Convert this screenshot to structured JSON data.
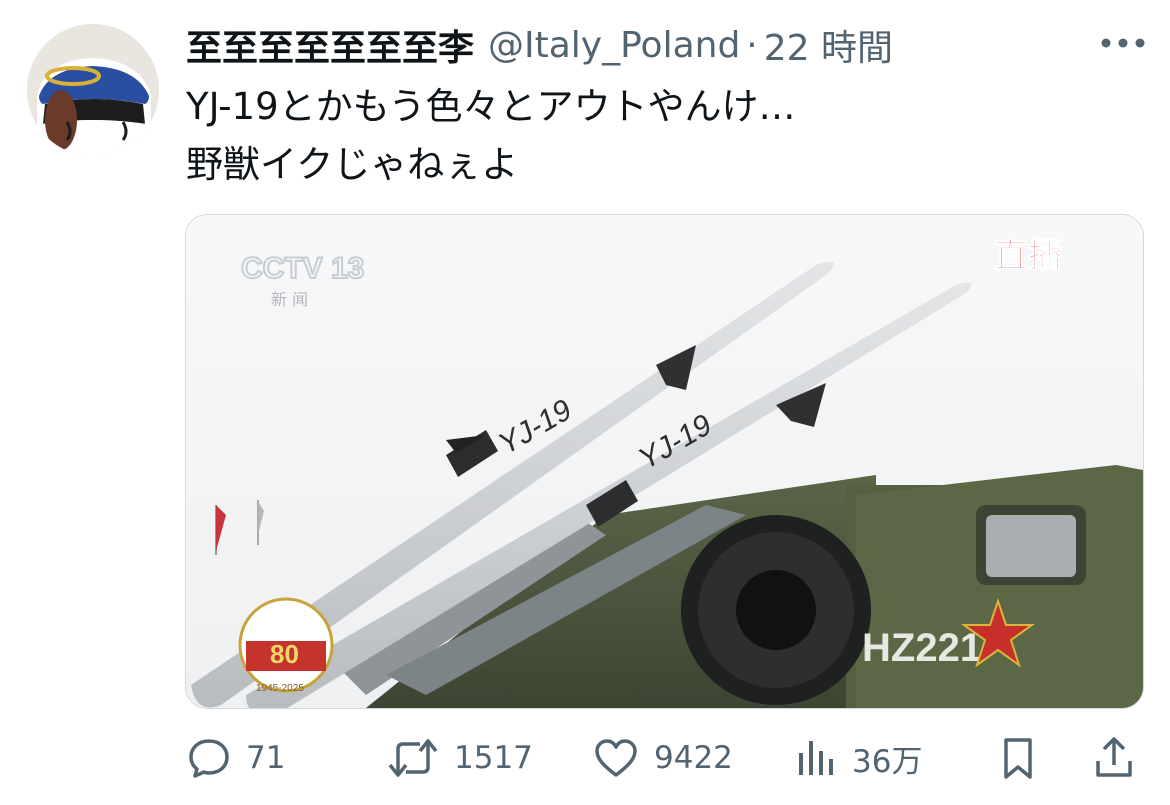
{
  "tweet": {
    "display_name": "至至至至至至至李",
    "handle": "@Italy_Poland",
    "separator": "·",
    "time": "22 時間",
    "text_lines": [
      "YJ-19とかもう色々とアウトやんけ…",
      "野獣イクじゃねぇよ"
    ]
  },
  "media": {
    "channel_logo": "CCTV 13",
    "channel_sub": "新 闻",
    "live_badge": "直播",
    "missile_label": "YJ-19",
    "vehicle_code": "HZ221",
    "anniversary_number": "80",
    "anniversary_years": "1945-2025"
  },
  "actions": {
    "reply_count": "71",
    "retweet_count": "1517",
    "like_count": "9422",
    "view_count": "36万"
  },
  "icons": [
    "more-icon",
    "reply-icon",
    "retweet-icon",
    "like-icon",
    "views-icon",
    "bookmark-icon",
    "share-icon"
  ],
  "colors": {
    "text": "#0f1419",
    "secondary": "#536471",
    "border": "#cfd9de"
  }
}
